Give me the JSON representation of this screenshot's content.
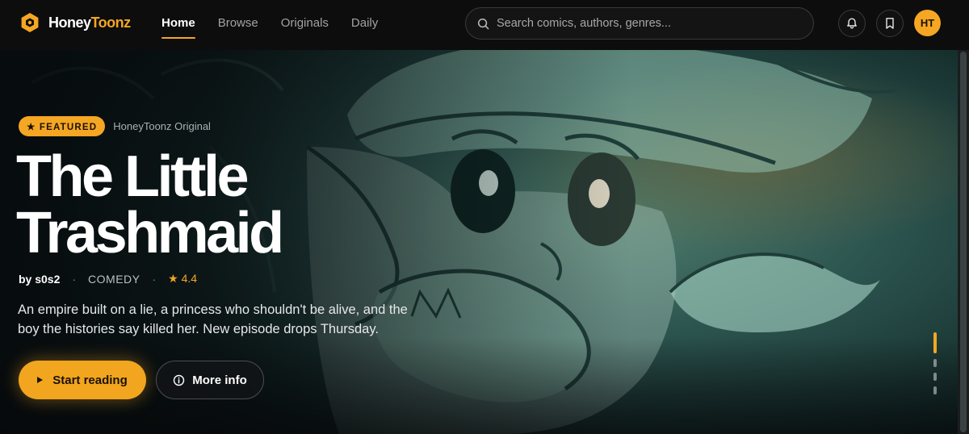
{
  "brand": {
    "name_part1": "Honey",
    "name_part2": "Toonz",
    "accent_color": "#f5a623"
  },
  "nav": {
    "items": [
      {
        "label": "Home",
        "active": true
      },
      {
        "label": "Browse",
        "active": false
      },
      {
        "label": "Originals",
        "active": false
      },
      {
        "label": "Daily",
        "active": false
      }
    ]
  },
  "search": {
    "placeholder": "Search comics, authors, genres...",
    "value": ""
  },
  "header_icons": {
    "notifications": "bell-icon",
    "bookmarks": "bookmark-icon"
  },
  "user": {
    "initials": "HT"
  },
  "hero": {
    "badge": "★ FEATURED",
    "badge_sub": "HoneyToonz Original",
    "title": "The Little Trashmaid",
    "author": "by s0s2",
    "separator": "·",
    "genre": "COMEDY",
    "rating": "★ 4.4",
    "description": "An empire built on a lie, a princess who shouldn't be alive, and the boy the histories say killed her. New episode drops Thursday.",
    "primary_button": "Start reading",
    "secondary_button": "More info",
    "slides_total": 4,
    "slide_active": 1
  }
}
